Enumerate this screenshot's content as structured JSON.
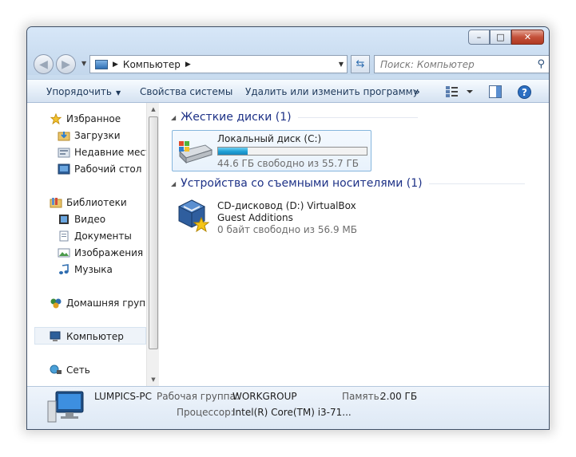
{
  "window": {
    "caption_buttons": {
      "minimize": "–",
      "maximize": "□",
      "close": "✕"
    }
  },
  "address_bar": {
    "crumb": "Компьютер"
  },
  "search": {
    "placeholder": "Поиск: Компьютер"
  },
  "toolbar": {
    "organize": "Упорядочить",
    "system_properties": "Свойства системы",
    "uninstall": "Удалить или изменить программу",
    "more": "»"
  },
  "nav": {
    "favorites": "Избранное",
    "downloads": "Загрузки",
    "recent": "Недавние места",
    "desktop": "Рабочий стол",
    "libraries": "Библиотеки",
    "video": "Видео",
    "documents": "Документы",
    "pictures": "Изображения",
    "music": "Музыка",
    "homegroup": "Домашняя группа",
    "computer": "Компьютер",
    "network": "Сеть"
  },
  "groups": {
    "hard_drives": "Жесткие диски (1)",
    "removable": "Устройства со съемными носителями (1)"
  },
  "drive_c": {
    "name": "Локальный диск (C:)",
    "free_text": "44.6 ГБ свободно из 55.7 ГБ",
    "used_fraction": 0.2
  },
  "drive_d": {
    "name": "CD-дисковод (D:) VirtualBox Guest Additions",
    "free_text": "0 байт свободно из 56.9 МБ"
  },
  "details": {
    "pc_name": "LUMPICS-PC",
    "workgroup_label": "Рабочая группа:",
    "workgroup_value": "WORKGROUP",
    "memory_label": "Память:",
    "memory_value": "2.00 ГБ",
    "cpu_label": "Процессор:",
    "cpu_value": "Intel(R) Core(TM) i3-71..."
  }
}
